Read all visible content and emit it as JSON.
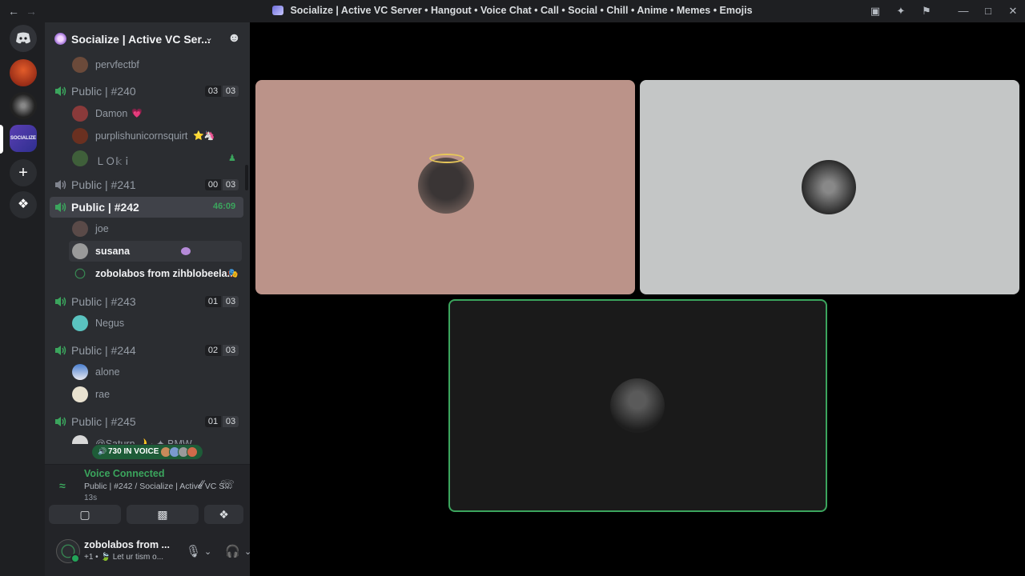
{
  "window": {
    "title": "Socialize | Active VC Server • Hangout • Voice Chat • Call • Social • Chill • Anime • Memes • Emojis",
    "back_icon": "arrow-left-icon",
    "forward_icon": "arrow-right-icon"
  },
  "server": {
    "name": "Socialize | Active VC Ser...",
    "rail_label": "SOCIALIZE"
  },
  "channels": [
    {
      "name": "Public | #240",
      "count_a": "03",
      "count_b": "03",
      "users": [
        {
          "name": "Damon",
          "badge": "💗"
        },
        {
          "name": "purplishunicornsquirt",
          "badge": "⭐🦄"
        },
        {
          "name": "ＬＯ𝕜ｉ",
          "badge": "♟"
        }
      ]
    },
    {
      "name": "Public | #241",
      "count_a": "00",
      "count_b": "03",
      "users": []
    },
    {
      "name": "Public | #242",
      "timer": "46:09",
      "active": true,
      "users": [
        {
          "name": "joe"
        },
        {
          "name": "susana"
        },
        {
          "name": "zobolabos from zihblobeela...",
          "badge": "🎭"
        }
      ]
    },
    {
      "name": "Public | #243",
      "count_a": "01",
      "count_b": "03",
      "users": [
        {
          "name": "Negus"
        }
      ]
    },
    {
      "name": "Public | #244",
      "count_a": "02",
      "count_b": "03",
      "users": [
        {
          "name": "alone"
        },
        {
          "name": "rae"
        }
      ]
    },
    {
      "name": "Public | #245",
      "count_a": "01",
      "count_b": "03",
      "users": [
        {
          "name": "@Saturn🌙 · ✦ BMW"
        }
      ]
    }
  ],
  "top_partial_user": "pervfectbf",
  "in_voice_pill": "730 IN VOICE",
  "voice": {
    "status": "Voice Connected",
    "channel": "Public | #242 / Socialize | Active VC S...",
    "elapsed": "13s"
  },
  "user": {
    "name": "zobolabos from ...",
    "status": "+1 • 🍃 Let ur tism o..."
  },
  "colors": {
    "accent_green": "#3ba55d",
    "tile_pink": "#bb9389",
    "tile_gray": "#c4c6c6",
    "tile_dark": "#1a1a1a"
  }
}
